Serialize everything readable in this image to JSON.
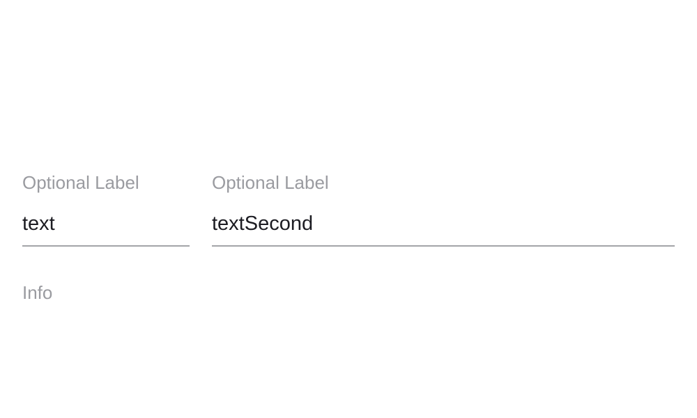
{
  "form": {
    "first_field": {
      "label": "Optional Label",
      "value": "text"
    },
    "second_field": {
      "label": "Optional Label",
      "value": "textSecond"
    },
    "info_text": "Info"
  },
  "colors": {
    "label": "#9a9ba0",
    "input_text": "#1c1c22",
    "underline": "#a3a4a8",
    "background": "#ffffff"
  }
}
